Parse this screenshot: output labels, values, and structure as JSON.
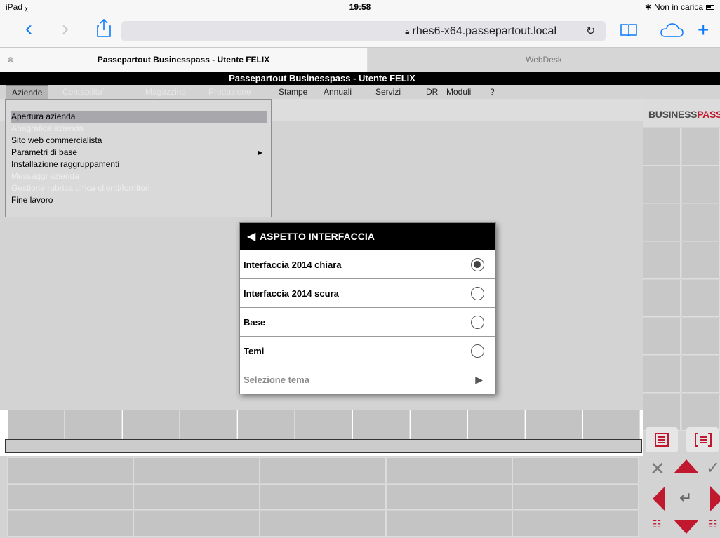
{
  "ios_status": {
    "device": "iPad ᵪ",
    "time": "19:58",
    "charging": "✱ Non in carica"
  },
  "safari": {
    "url": "rhes6-x64.passepartout.local",
    "tabs": [
      "Passepartout Businesspass - Utente FELIX",
      "WebDesk"
    ]
  },
  "app": {
    "title": "Passepartout Businesspass - Utente FELIX",
    "menus": [
      {
        "label": "Aziende",
        "enabled": true
      },
      {
        "label": "Contabilita'",
        "enabled": false
      },
      {
        "label": "Magazzino",
        "enabled": false
      },
      {
        "label": "Produzione",
        "enabled": false
      },
      {
        "label": "Stampe",
        "enabled": true
      },
      {
        "label": "Annuali",
        "enabled": true
      },
      {
        "label": "Servizi",
        "enabled": true
      },
      {
        "label": "DR",
        "enabled": true
      },
      {
        "label": "Moduli",
        "enabled": true
      },
      {
        "label": "?",
        "enabled": true
      }
    ],
    "dropdown": [
      {
        "label": "Apertura azienda",
        "enabled": true,
        "selected": true
      },
      {
        "label": "Anagrafica azienda",
        "enabled": false
      },
      {
        "label": "Sito web commercialista",
        "enabled": true
      },
      {
        "label": "Parametri di base",
        "enabled": true,
        "submenu": true
      },
      {
        "label": "Installazione raggruppamenti",
        "enabled": true
      },
      {
        "label": "Messaggi azienda",
        "enabled": false
      },
      {
        "label": "Gestione rubrica unica clienti/fornitori",
        "enabled": false
      },
      {
        "label": "Fine lavoro",
        "enabled": true
      }
    ],
    "logo": {
      "part1": "BUSINESS",
      "part2": "PASS"
    }
  },
  "modal": {
    "title": "ASPETTO INTERFACCIA",
    "options": [
      {
        "label": "Interfaccia 2014 chiara",
        "selected": true
      },
      {
        "label": "Interfaccia 2014 scura",
        "selected": false
      },
      {
        "label": "Base",
        "selected": false
      },
      {
        "label": "Temi",
        "selected": false
      }
    ],
    "theme_select": "Selezione tema"
  },
  "colors": {
    "accent_red": "#c0182f",
    "ios_blue": "#0a7aff"
  }
}
